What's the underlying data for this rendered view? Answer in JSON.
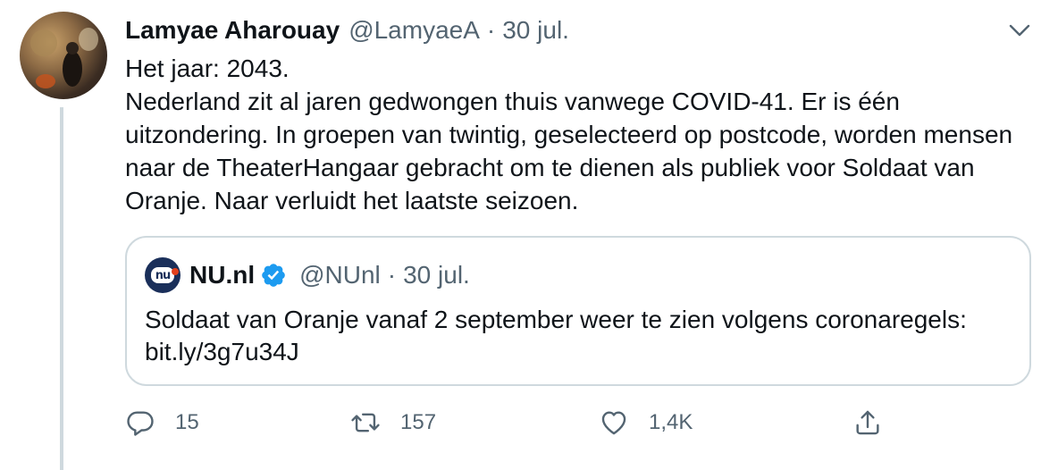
{
  "tweet": {
    "author_name": "Lamyae Aharouay",
    "author_handle": "@LamyaeA",
    "separator": "·",
    "date": "30 jul.",
    "text_lines": [
      "Het jaar: 2043.",
      "Nederland zit al jaren gedwongen thuis vanwege COVID-41. Er is één uitzondering. In groepen van twintig, geselecteerd op postcode, worden mensen naar de TheaterHangaar gebracht om te dienen als publiek voor Soldaat van Oranje. Naar verluidt het laatste seizoen."
    ]
  },
  "quote": {
    "author_name": "NU.nl",
    "author_handle": "@NUnl",
    "separator": "·",
    "date": "30 jul.",
    "avatar_text": "nu",
    "text": "Soldaat van Oranje vanaf 2 september weer te zien volgens coronaregels: bit.ly/3g7u34J"
  },
  "actions": {
    "reply_count": "15",
    "retweet_count": "157",
    "like_count": "1,4K"
  },
  "icons": {
    "menu": "chevron-down-icon",
    "verified": "verified-badge-icon",
    "reply": "reply-icon",
    "retweet": "retweet-icon",
    "like": "heart-icon",
    "share": "share-icon"
  },
  "colors": {
    "text_primary": "#0f1419",
    "text_secondary": "#536471",
    "border": "#cfd9de",
    "verified_blue": "#1d9bf0"
  }
}
